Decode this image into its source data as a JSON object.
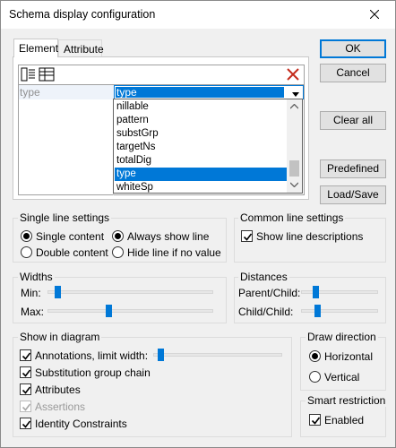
{
  "window": {
    "title": "Schema display configuration"
  },
  "tabs": [
    {
      "label": "Element"
    },
    {
      "label": "Attribute"
    }
  ],
  "grid": {
    "row": {
      "name": "type",
      "value": "type"
    },
    "dropdown_items": [
      "nillable",
      "pattern",
      "substGrp",
      "targetNs",
      "totalDig",
      "type",
      "whiteSp"
    ],
    "selected_item": "type"
  },
  "buttons": {
    "ok": "OK",
    "cancel": "Cancel",
    "clear_all": "Clear all",
    "predefined": "Predefined",
    "load_save": "Load/Save"
  },
  "single_line": {
    "title": "Single line settings",
    "single_content": "Single content",
    "double_content": "Double content",
    "always_show_line": "Always show line",
    "hide_line": "Hide line if no value"
  },
  "common_line": {
    "title": "Common line settings",
    "show_descriptions": "Show line descriptions"
  },
  "widths": {
    "title": "Widths",
    "min": "Min:",
    "max": "Max:"
  },
  "distances": {
    "title": "Distances",
    "parent_child_1": "Parent/Child:",
    "parent_child_2": "Child/Child:"
  },
  "show_in_diagram": {
    "title": "Show in diagram",
    "annotations": "Annotations, limit width:",
    "subst_group": "Substitution group chain",
    "attributes": "Attributes",
    "assertions": "Assertions",
    "identity": "Identity Constraints"
  },
  "draw_direction": {
    "title": "Draw direction",
    "horizontal": "Horizontal",
    "vertical": "Vertical"
  },
  "smart_restriction": {
    "title": "Smart restriction",
    "enabled": "Enabled"
  },
  "colors": {
    "accent": "#0078d7",
    "background": "#f0f0f0"
  }
}
